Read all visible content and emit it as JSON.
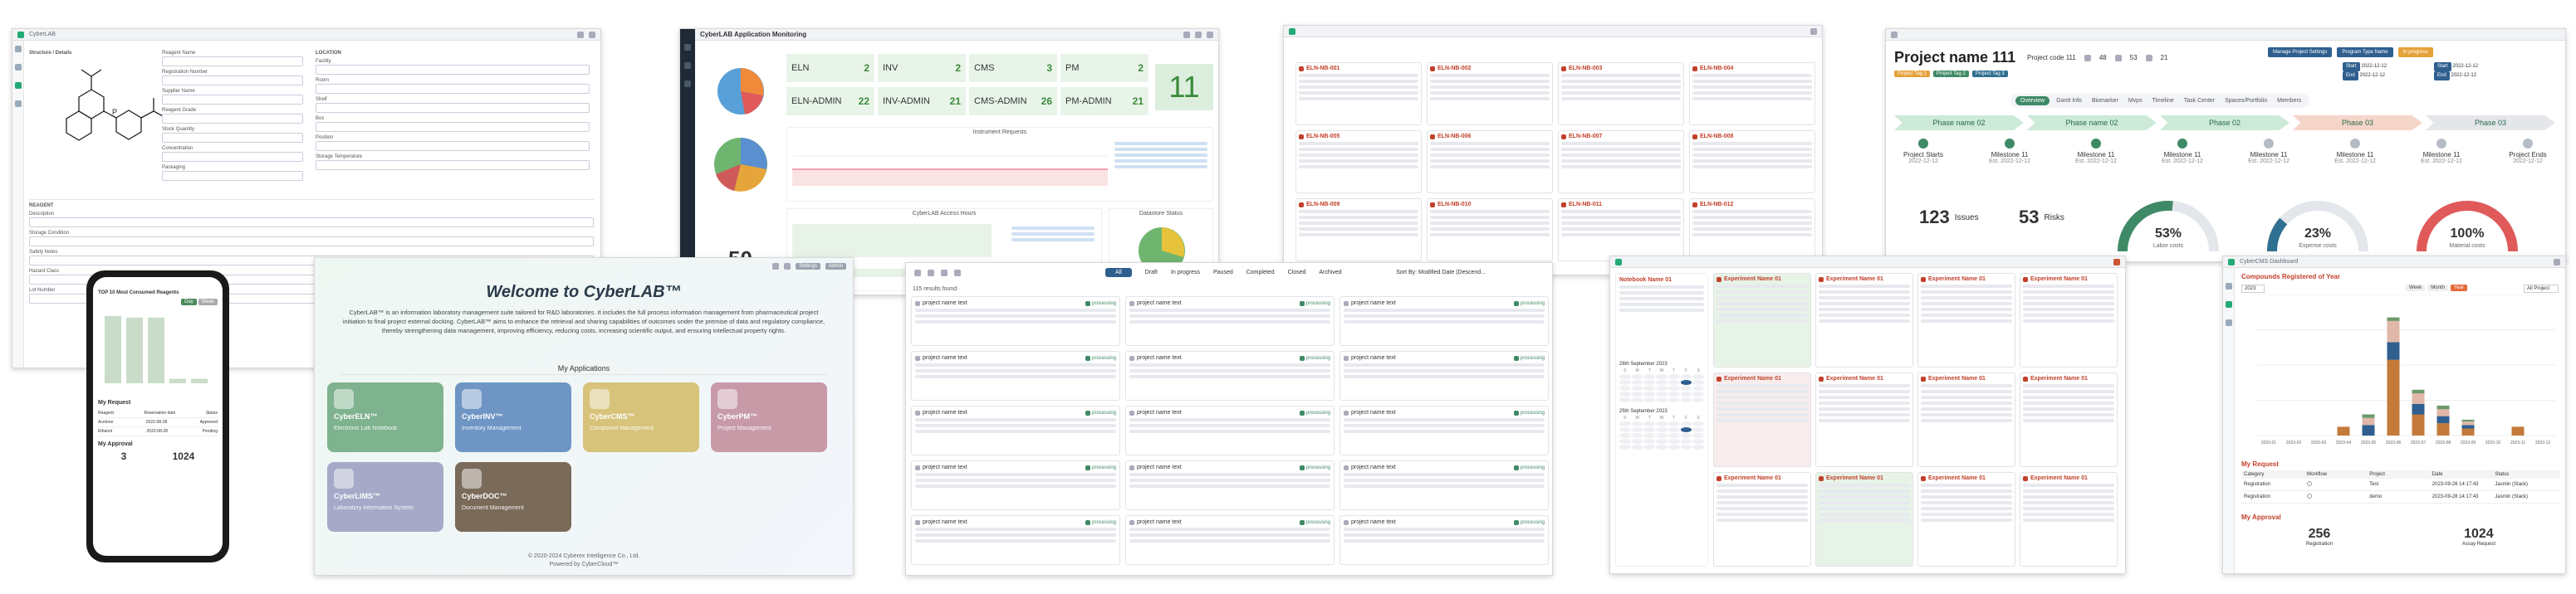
{
  "panel_form": {
    "title": "CyberLAB",
    "section_structure": "Structure / Details",
    "section_location": "LOCATION",
    "section_reagent": "REAGENT",
    "fields_left": [
      "Reagent Name",
      "Registration Number",
      "Supplier Name",
      "Reagent Grade",
      "Stock Quantity",
      "Concentration",
      "Packaging"
    ],
    "fields_right": [
      "Facility",
      "Room",
      "Shelf",
      "Box",
      "Position",
      "Storage Temperature"
    ],
    "fields_bottom": [
      "Description",
      "Storage Condition",
      "Safety Notes",
      "Hazard Class",
      "Lot Number"
    ]
  },
  "panel_monitor": {
    "title": "CyberLAB Application Monitoring",
    "stats": [
      {
        "label": "ELN",
        "value": "2"
      },
      {
        "label": "INV",
        "value": "2"
      },
      {
        "label": "CMS",
        "value": "3"
      },
      {
        "label": "PM",
        "value": "2"
      },
      {
        "label": "ELN-ADMIN",
        "value": "22"
      },
      {
        "label": "INV-ADMIN",
        "value": "21"
      },
      {
        "label": "CMS-ADMIN",
        "value": "26"
      },
      {
        "label": "PM-ADMIN",
        "value": "21"
      }
    ],
    "big_value": "11",
    "total_value": "50",
    "section_requests": "Instrument Requests",
    "section_hours": "CyberLAB Access Hours",
    "section_datastore": "Datastore Status"
  },
  "panel_notebook_grid": {
    "items": [
      "ELN-NB-001",
      "ELN-NB-002",
      "ELN-NB-003",
      "ELN-NB-004",
      "ELN-NB-005",
      "ELN-NB-006",
      "ELN-NB-007",
      "ELN-NB-008",
      "ELN-NB-009",
      "ELN-NB-010",
      "ELN-NB-011",
      "ELN-NB-012"
    ]
  },
  "panel_project": {
    "title": "Project name 111",
    "project_id_label": "Project code 111",
    "counts": [
      "48",
      "53",
      "21"
    ],
    "tags": [
      "Project Tag 1",
      "Project Tag 2",
      "Project Tag 3"
    ],
    "buttons": [
      "Manage Project Settings",
      "Program Type Name",
      "In progress"
    ],
    "dates": [
      "2022-12-12",
      "2022-12-12",
      "2022-12-12",
      "2022-12-12"
    ],
    "tabs": [
      "Overview",
      "Gantt Info",
      "Biomarker",
      "Mvps",
      "Timeline",
      "Task Center",
      "Spaces/Portfolio",
      "Members"
    ],
    "phases": [
      "Phase name 02",
      "Phase name 02",
      "Phase 02",
      "Phase 03",
      "Phase 03"
    ],
    "milestones": [
      {
        "name": "Project Starts",
        "date": "2022-12-12"
      },
      {
        "name": "Milestone 11",
        "date": "Est. 2022-12-12"
      },
      {
        "name": "Milestone 11",
        "date": "Est. 2022-12-12"
      },
      {
        "name": "Milestone 11",
        "date": "Est. 2022-12-12"
      },
      {
        "name": "Milestone 11",
        "date": "Est. 2022-12-12"
      },
      {
        "name": "Milestone 11",
        "date": "Est. 2022-12-12"
      },
      {
        "name": "Milestone 11",
        "date": "Est. 2022-12-12"
      },
      {
        "name": "Project Ends",
        "date": "2022-12-12"
      }
    ],
    "issues_value": "123",
    "issues_label": "Issues",
    "risks_value": "53",
    "risks_label": "Risks",
    "gauges": [
      {
        "value": "53%",
        "label": "Labor costs",
        "fraction": 0.53,
        "color": "#3f8a66"
      },
      {
        "value": "23%",
        "label": "Expense costs",
        "fraction": 0.23,
        "color": "#2f6f8f"
      },
      {
        "value": "100%",
        "label": "Material costs",
        "fraction": 1.0,
        "color": "#e05a5a"
      }
    ]
  },
  "panel_mobile": {
    "chart_title": "TOP 10 Most Consumed Reagents",
    "btn_a": "Day",
    "btn_b": "Week",
    "request_title": "My Request",
    "approval_title": "My Approval",
    "approval_values": [
      "3",
      "1024"
    ],
    "request_rows": [
      {
        "col1": "Reagent",
        "col2": "Reservation date",
        "col3": "Status"
      },
      {
        "col1": "Acetone",
        "col2": "2022-08-28",
        "col3": "Approved"
      },
      {
        "col1": "Ethanol",
        "col2": "2022-08-28",
        "col3": "Pending"
      }
    ]
  },
  "panel_welcome": {
    "title": "Welcome to CyberLAB™",
    "description": "CyberLAB™ is an information laboratory management suite tailored for R&D laboratories. It includes the full process information management from pharmaceutical project initiation to final project external docking. CyberLAB™ aims to enhance the retrieval and sharing capabilities of outcomes under the premise of data and regulatory compliance, thereby strengthening data management, improving efficiency, reducing costs, increasing scientific output, and ensuring intellectual property rights.",
    "section_title": "My Applications",
    "apps": [
      {
        "name": "CyberELN™",
        "desc": "Electronic Lab Notebook",
        "color": "#7fb28f"
      },
      {
        "name": "CyberINV™",
        "desc": "Inventory Management",
        "color": "#6e95c4"
      },
      {
        "name": "CyberCMS™",
        "desc": "Compound Management",
        "color": "#d7c37a"
      },
      {
        "name": "CyberPM™",
        "desc": "Project Management",
        "color": "#c89aa8"
      },
      {
        "name": "CyberLIMS™",
        "desc": "Laboratory Information System",
        "color": "#a6a9c7"
      },
      {
        "name": "CyberDOC™",
        "desc": "Document Management",
        "color": "#7a6a5a"
      }
    ],
    "settings_label": "Settings",
    "user_label": "Admin",
    "copyright": "© 2020-2024 Cyberex Intelligence Co., Ltd.",
    "powered": "Powered by CyberCloud™"
  },
  "panel_projects_list": {
    "tabs": [
      "All",
      "Draft",
      "In progress",
      "Paused",
      "Completed",
      "Closed",
      "Archived"
    ],
    "sort_label": "Sort By: Modified Date (Descend...",
    "results": "115 results found",
    "card_title": "project name text",
    "card_tag": "processing"
  },
  "panel_eln": {
    "notebook_title": "Notebook Name 01",
    "experiment_title": "Experiment Name 01",
    "calendar_month_a": "26th September 2023",
    "calendar_month_b": "25th September 2023",
    "week_days": [
      "S",
      "M",
      "T",
      "W",
      "T",
      "F",
      "S"
    ]
  },
  "panel_compounds": {
    "title": "CyberCMS Dashboard",
    "chart_title": "Compounds Registered of Year",
    "filter_btns": [
      "Week",
      "Month",
      "Year"
    ],
    "filter_select": "All Project",
    "year_select": "2023",
    "request_title": "My Request",
    "request_headers": [
      "Category",
      "Workflow",
      "Project",
      "Date",
      "Status"
    ],
    "request_rows": [
      {
        "category": "Registration",
        "project": "Test",
        "date": "2023-09-28 14:17:43",
        "status": "Jasmin (Stack)"
      },
      {
        "category": "Registration",
        "project": "demo",
        "date": "2023-09-28 14:17:43",
        "status": "Jasmin (Stack)"
      }
    ],
    "approval_title": "My Approval",
    "approval_values": [
      {
        "value": "256",
        "label": "Registration"
      },
      {
        "value": "1024",
        "label": "Assay Request"
      }
    ]
  },
  "chart_data": [
    {
      "type": "bar",
      "title": "Compounds Registered of Year",
      "categories": [
        "2023-01",
        "2023-02",
        "2023-03",
        "2023-04",
        "2023-05",
        "2023-06",
        "2023-07",
        "2023-08",
        "2023-09",
        "2023-10",
        "2023-11",
        "2023-12"
      ],
      "series": [
        {
          "values": [
            0,
            0,
            0,
            50,
            0,
            430,
            120,
            70,
            40,
            0,
            50,
            0
          ],
          "color": "#c47a3a"
        },
        {
          "values": [
            0,
            0,
            0,
            0,
            60,
            100,
            60,
            40,
            20,
            0,
            0,
            0
          ],
          "color": "#2f5f8f"
        },
        {
          "values": [
            0,
            0,
            0,
            0,
            40,
            120,
            60,
            40,
            20,
            0,
            0,
            0
          ],
          "color": "#e0b7a8"
        },
        {
          "values": [
            0,
            0,
            0,
            0,
            20,
            20,
            20,
            20,
            10,
            0,
            0,
            0
          ],
          "color": "#6b9a6b"
        }
      ],
      "ylim": [
        0,
        800
      ]
    },
    {
      "type": "bar",
      "title": "TOP 10 Most Consumed Reagents",
      "categories": [
        "1",
        "2",
        "3",
        "4",
        "5"
      ],
      "values": [
        90,
        88,
        88,
        6,
        6
      ],
      "ylim": [
        0,
        100
      ]
    }
  ]
}
